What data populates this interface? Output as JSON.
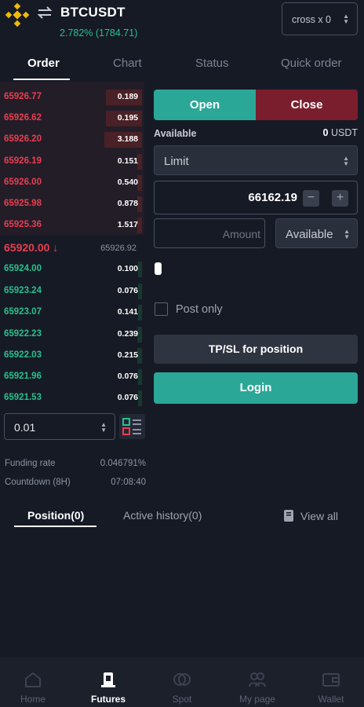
{
  "header": {
    "symbol": "BTCUSDT",
    "change": "2.782% (1784.71)",
    "cross_label": "cross x 0"
  },
  "tabs": [
    {
      "label": "Order"
    },
    {
      "label": "Chart"
    },
    {
      "label": "Status"
    },
    {
      "label": "Quick order"
    }
  ],
  "orderbook": {
    "asks": [
      {
        "price": "65926.77",
        "qty": "0.189"
      },
      {
        "price": "65926.62",
        "qty": "0.195"
      },
      {
        "price": "65926.20",
        "qty": "3.188"
      },
      {
        "price": "65926.19",
        "qty": "0.151"
      },
      {
        "price": "65926.00",
        "qty": "0.540"
      },
      {
        "price": "65925.98",
        "qty": "0.878"
      },
      {
        "price": "65925.36",
        "qty": "1.517"
      }
    ],
    "last_price": "65920.00 ↓",
    "mark_price": "65926.92",
    "bids": [
      {
        "price": "65924.00",
        "qty": "0.100"
      },
      {
        "price": "65923.24",
        "qty": "0.076"
      },
      {
        "price": "65923.07",
        "qty": "0.141"
      },
      {
        "price": "65922.23",
        "qty": "0.239"
      },
      {
        "price": "65922.03",
        "qty": "0.215"
      },
      {
        "price": "65921.96",
        "qty": "0.076"
      },
      {
        "price": "65921.53",
        "qty": "0.076"
      }
    ],
    "precision": "0.01"
  },
  "funding": {
    "rate_label": "Funding rate",
    "rate_value": "0.046791%",
    "countdown_label": "Countdown (8H)",
    "countdown_value": "07:08:40"
  },
  "order_form": {
    "open_label": "Open",
    "close_label": "Close",
    "available_label": "Available",
    "available_amount": "0",
    "available_unit": "USDT",
    "order_type": "Limit",
    "price": "66162.19",
    "minus": "−",
    "plus": "+",
    "amount_placeholder": "Amount",
    "unit": "Available",
    "post_only_label": "Post only",
    "tpsl_label": "TP/SL for position",
    "login_label": "Login"
  },
  "positions": {
    "tab_position": "Position(0)",
    "tab_history": "Active history(0)",
    "view_all": "View all"
  },
  "bottom_nav": [
    {
      "label": "Home",
      "icon": "home-icon"
    },
    {
      "label": "Futures",
      "icon": "futures-icon"
    },
    {
      "label": "Spot",
      "icon": "spot-icon"
    },
    {
      "label": "My page",
      "icon": "user-icon"
    },
    {
      "label": "Wallet",
      "icon": "wallet-icon"
    }
  ],
  "colors": {
    "background": "#161a25",
    "buy": "#27c08e",
    "sell": "#ea3d4f",
    "open_button": "#2ba797",
    "close_button": "#7a1e2d"
  }
}
